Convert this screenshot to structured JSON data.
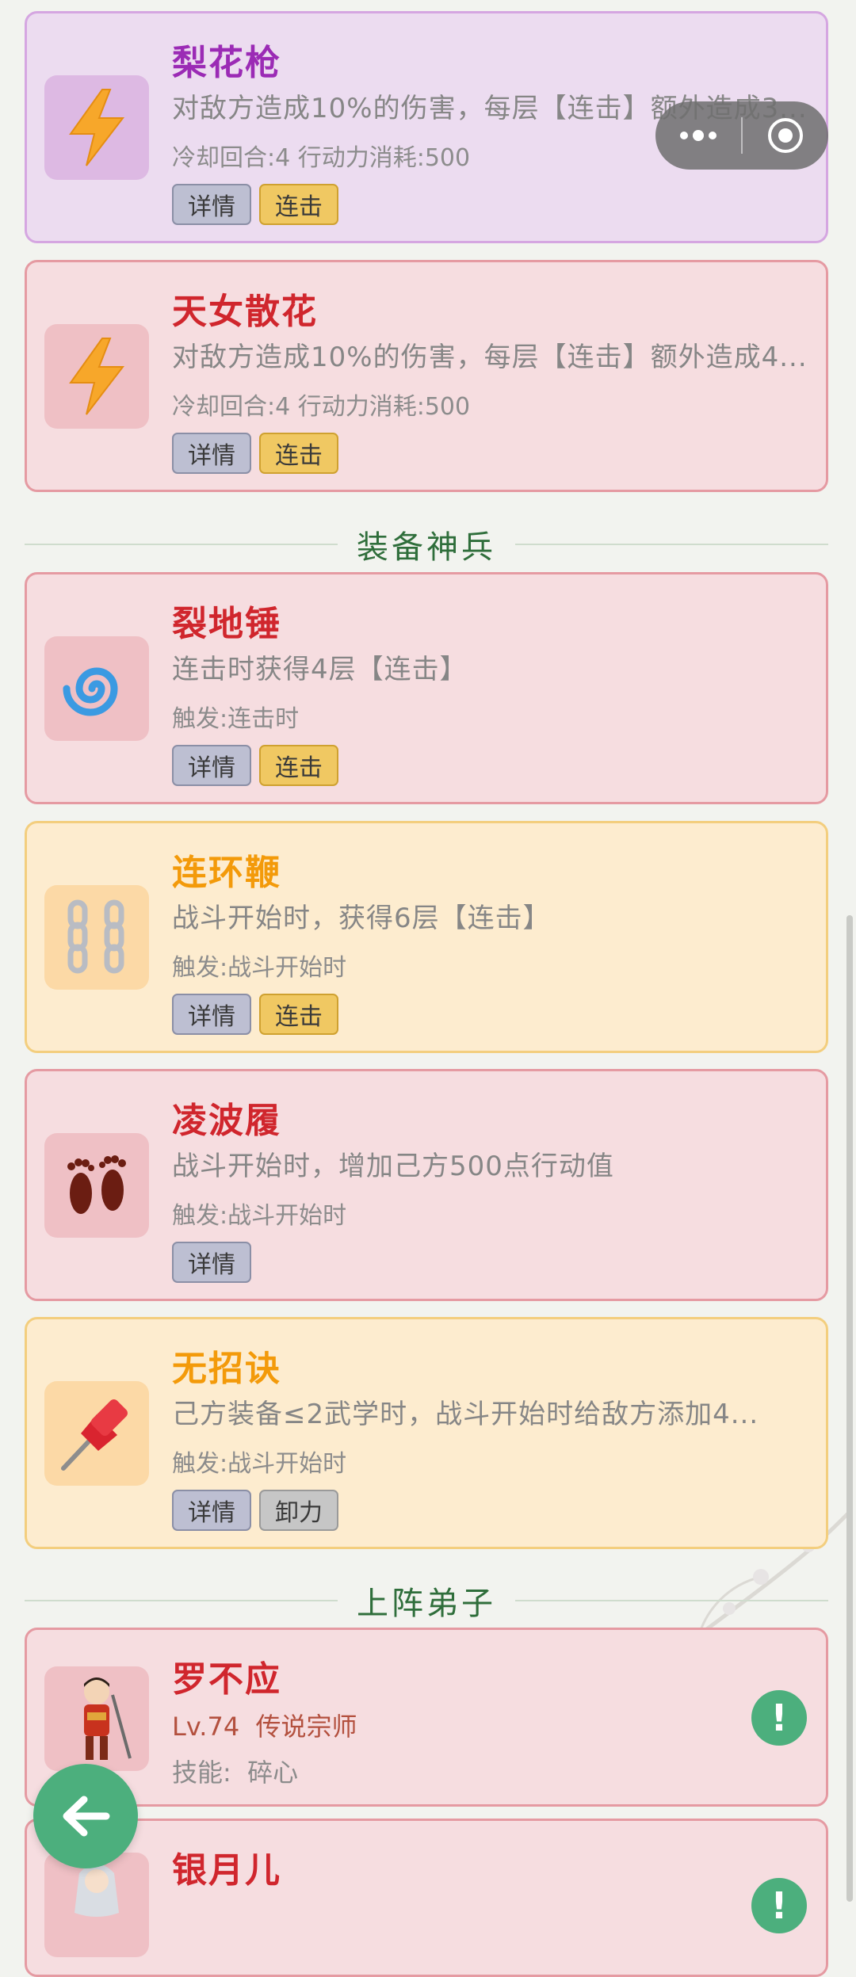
{
  "skills": [
    {
      "name": "梨花枪",
      "desc": "对敌方造成10%的伤害，每层【连击】额外造成3...",
      "meta": "冷却回合:4  行动力消耗:500",
      "tags": [
        "详情",
        "连击"
      ],
      "icon": "lightning-icon"
    },
    {
      "name": "天女散花",
      "desc": "对敌方造成10%的伤害，每层【连击】额外造成4...",
      "meta": "冷却回合:4  行动力消耗:500",
      "tags": [
        "详情",
        "连击"
      ],
      "icon": "lightning-icon"
    }
  ],
  "sections": {
    "equipment": "装备神兵",
    "disciples": "上阵弟子"
  },
  "equipment": [
    {
      "name": "裂地锤",
      "desc": "连击时获得4层【连击】",
      "meta": "触发:连击时",
      "tags": [
        "详情",
        "连击"
      ],
      "icon": "cyclone-icon"
    },
    {
      "name": "连环鞭",
      "desc": "战斗开始时，获得6层【连击】",
      "meta": "触发:战斗开始时",
      "tags": [
        "详情",
        "连击"
      ],
      "icon": "chain-icon"
    },
    {
      "name": "凌波履",
      "desc": "战斗开始时，增加己方500点行动值",
      "meta": "触发:战斗开始时",
      "tags": [
        "详情"
      ],
      "icon": "footprints-icon"
    },
    {
      "name": "无招诀",
      "desc": "己方装备≤2武学时，战斗开始时给敌方添加4...",
      "meta": "触发:战斗开始时",
      "tags": [
        "详情",
        "卸力"
      ],
      "icon": "pushpin-icon"
    }
  ],
  "disciples": [
    {
      "name": "罗不应",
      "level": "Lv.74",
      "rank": "传说宗师",
      "skill_label": "技能:",
      "skill": "碎心"
    },
    {
      "name": "银月儿"
    }
  ],
  "colors": {
    "accent_green": "#4caf7d",
    "title_red": "#d0262d",
    "title_purple": "#9b2bb5",
    "title_orange": "#f39a0a"
  }
}
